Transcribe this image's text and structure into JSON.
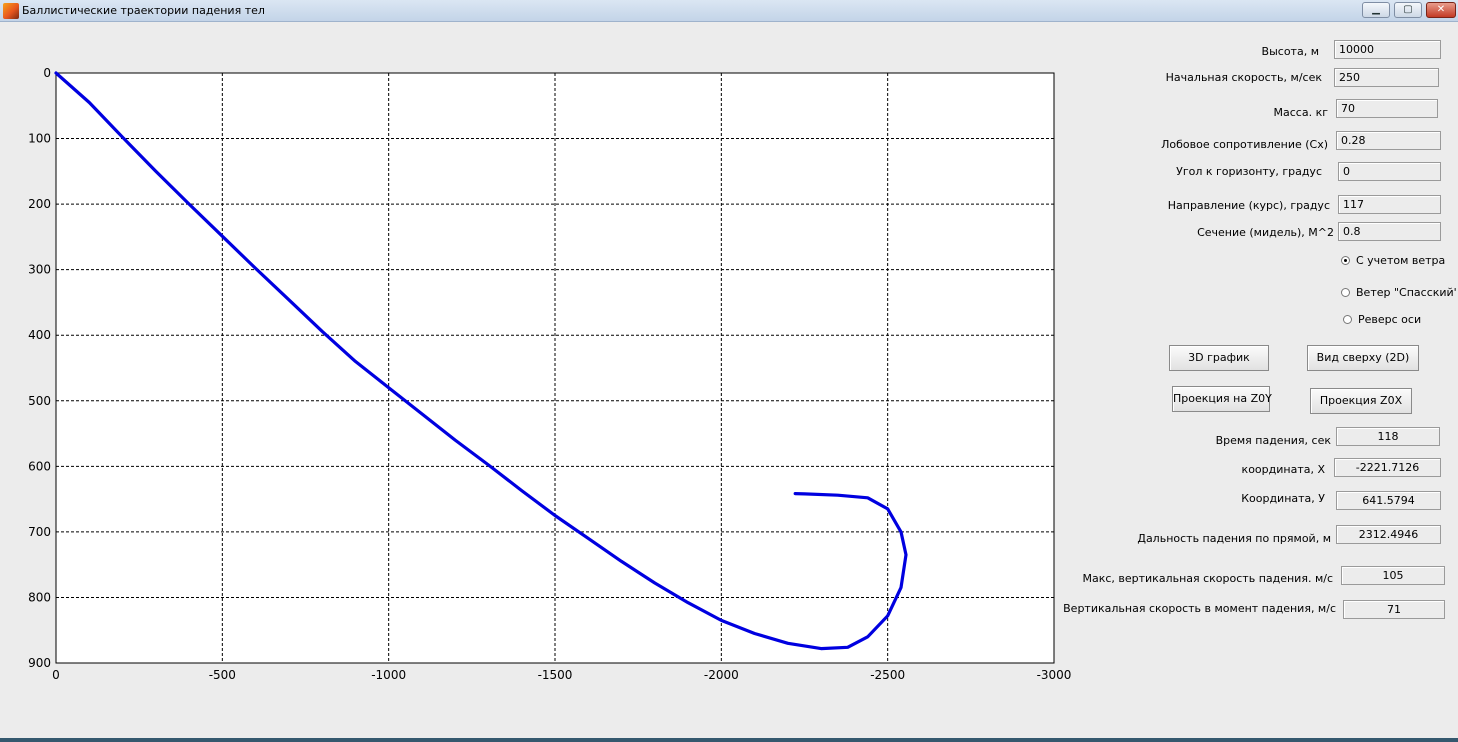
{
  "window": {
    "title": "Баллистические траектории падения тел",
    "icon": "matlab-icon",
    "controls": [
      "minimize-icon",
      "maximize-icon",
      "close-icon"
    ]
  },
  "inputs": [
    {
      "label": "Высота, м",
      "value": "10000"
    },
    {
      "label": "Начальная скорость, м/сек",
      "value": "250"
    },
    {
      "label": "Масса. кг",
      "value": "70"
    },
    {
      "label": "Лобовое сопротивление (Cx)",
      "value": "0.28"
    },
    {
      "label": "Угол к горизонту, градус",
      "value": "0"
    },
    {
      "label": "Направление  (курс), градус",
      "value": "117"
    },
    {
      "label": "Сечение (мидель), М^2",
      "value": "0.8"
    }
  ],
  "radios": [
    {
      "label": "С учетом ветра",
      "selected": true
    },
    {
      "label": "Ветер \"Спасский'",
      "selected": false
    },
    {
      "label": "Реверс оси",
      "selected": false
    }
  ],
  "buttons": {
    "graph3d": "3D график",
    "top_view": "Вид сверху (2D)",
    "proj_zoy": "Проекция на Z0Y",
    "proj_zox": "Проекция Z0X"
  },
  "outputs": [
    {
      "label": "Время падения, сек",
      "value": "118"
    },
    {
      "label": "координата, X",
      "value": "-2221.7126"
    },
    {
      "label": "Координата, У",
      "value": "641.5794"
    },
    {
      "label": "Дальность падения по прямой, м",
      "value": "2312.4946"
    },
    {
      "label": "Макс,  вертикальная скорость падения. м/с",
      "value": "105"
    },
    {
      "label": "Вертикальная  скорость в момент падения, м/с",
      "value": "71"
    }
  ],
  "chart_data": {
    "type": "line",
    "title": "",
    "xlabel": "",
    "ylabel": "",
    "xlim": [
      0,
      -3000
    ],
    "ylim": [
      0,
      900
    ],
    "y_reversed": true,
    "grid": true,
    "xticks": [
      "0",
      "-500",
      "-1000",
      "-1500",
      "-2000",
      "-2500",
      "-3000"
    ],
    "yticks": [
      "0",
      "100",
      "200",
      "300",
      "400",
      "500",
      "600",
      "700",
      "800",
      "900"
    ],
    "series": [
      {
        "color": "#0000e0",
        "points": [
          [
            0,
            0
          ],
          [
            -100,
            45
          ],
          [
            -200,
            98
          ],
          [
            -300,
            150
          ],
          [
            -400,
            200
          ],
          [
            -500,
            249
          ],
          [
            -600,
            298
          ],
          [
            -700,
            346
          ],
          [
            -800,
            394
          ],
          [
            -900,
            440
          ],
          [
            -1000,
            480
          ],
          [
            -1100,
            520
          ],
          [
            -1200,
            560
          ],
          [
            -1300,
            598
          ],
          [
            -1400,
            637
          ],
          [
            -1500,
            675
          ],
          [
            -1600,
            710
          ],
          [
            -1700,
            745
          ],
          [
            -1800,
            778
          ],
          [
            -1900,
            808
          ],
          [
            -2000,
            835
          ],
          [
            -2100,
            855
          ],
          [
            -2200,
            870
          ],
          [
            -2300,
            878
          ],
          [
            -2380,
            876
          ],
          [
            -2440,
            860
          ],
          [
            -2500,
            828
          ],
          [
            -2540,
            785
          ],
          [
            -2555,
            735
          ],
          [
            -2540,
            700
          ],
          [
            -2500,
            665
          ],
          [
            -2440,
            648
          ],
          [
            -2350,
            644
          ],
          [
            -2250,
            642
          ],
          [
            -2222,
            641.6
          ]
        ]
      }
    ]
  }
}
